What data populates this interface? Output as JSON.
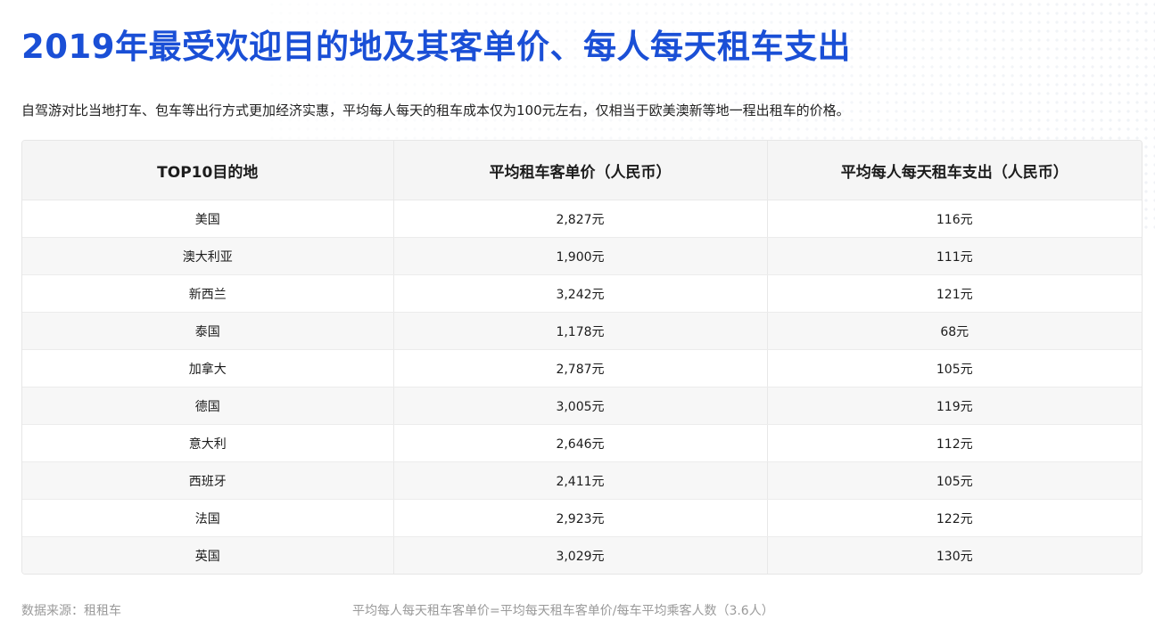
{
  "title": "2019年最受欢迎目的地及其客单价、每人每天租车支出",
  "subtitle": "自驾游对比当地打车、包车等出行方式更加经济实惠，平均每人每天的租车成本仅为100元左右，仅相当于欧美澳新等地一程出租车的价格。",
  "table": {
    "headers": [
      "TOP10目的地",
      "平均租车客单价（人民币）",
      "平均每人每天租车支出（人民币）"
    ],
    "rows": [
      [
        "美国",
        "2,827元",
        "116元"
      ],
      [
        "澳大利亚",
        "1,900元",
        "111元"
      ],
      [
        "新西兰",
        "3,242元",
        "121元"
      ],
      [
        "泰国",
        "1,178元",
        "68元"
      ],
      [
        "加拿大",
        "2,787元",
        "105元"
      ],
      [
        "德国",
        "3,005元",
        "119元"
      ],
      [
        "意大利",
        "2,646元",
        "112元"
      ],
      [
        "西班牙",
        "2,411元",
        "105元"
      ],
      [
        "法国",
        "2,923元",
        "122元"
      ],
      [
        "英国",
        "3,029元",
        "130元"
      ]
    ]
  },
  "footer": {
    "source": "数据来源：租租车",
    "note": "平均每人每天租车客单价=平均每天租车客单价/每车平均乘客人数（3.6人）"
  },
  "colors": {
    "title": "#1a4fd6",
    "header_bg": "#f5f5f5",
    "stripe_bg": "#f7f7f7",
    "footer_text": "#9a9a9a"
  }
}
